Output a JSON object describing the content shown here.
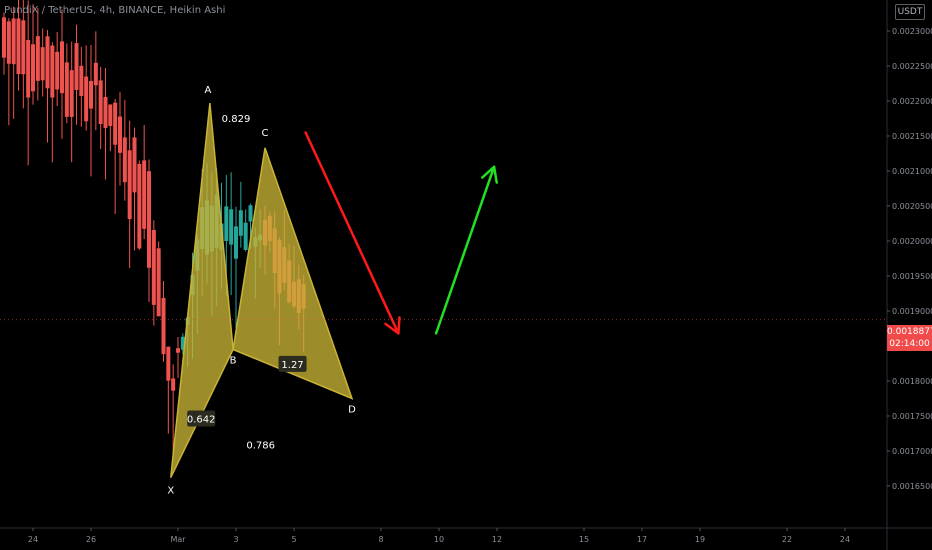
{
  "header": {
    "title": "PundiX / TetherUS, 4h, BINANCE, Heikin Ashi",
    "currency": "USDT"
  },
  "colors": {
    "background": "#000000",
    "up_candle": "#26a69a",
    "down_candle": "#ef5350",
    "pattern_fill": "#c9b336",
    "arrow_down": "#ff1a1a",
    "arrow_up": "#22e022",
    "price_tag": "#f04a4a"
  },
  "last_price": {
    "value": "0.0018877",
    "countdown": "02:14:00"
  },
  "chart_data": {
    "type": "candlestick",
    "title": "PundiX / TetherUS, 4h, BINANCE, Heikin Ashi",
    "y_axis": {
      "ticks": [
        "0.0023000",
        "0.0022500",
        "0.0022000",
        "0.0021500",
        "0.0021000",
        "0.0020500",
        "0.0020000",
        "0.0019500",
        "0.0019000",
        "0.0018500",
        "0.0018000",
        "0.0017500",
        "0.0017000",
        "0.0016500"
      ],
      "range": [
        0.00161,
        0.00234
      ]
    },
    "x_axis": {
      "ticks": [
        "24",
        "26",
        "Mar",
        "3",
        "5",
        "8",
        "10",
        "12",
        "15",
        "17",
        "19",
        "22",
        "24"
      ],
      "positions_days": [
        -5,
        -3,
        0,
        2,
        4,
        7,
        9,
        11,
        14,
        16,
        18,
        21,
        23
      ]
    },
    "pattern": {
      "name": "Harmonic (XABCD)",
      "points": [
        {
          "label": "X",
          "day": -0.25,
          "price": 0.001662
        },
        {
          "label": "A",
          "day": 1.1,
          "price": 0.002197
        },
        {
          "label": "B",
          "day": 1.9,
          "price": 0.001845
        },
        {
          "label": "C",
          "day": 3.0,
          "price": 0.002133
        },
        {
          "label": "D",
          "day": 6.0,
          "price": 0.001775
        }
      ],
      "ratios": [
        {
          "value": "0.829",
          "day": 2.0,
          "price": 0.002174
        },
        {
          "value": "0.642",
          "day": 0.8,
          "price": 0.001745,
          "boxed": true
        },
        {
          "value": "1.27",
          "day": 3.95,
          "price": 0.001823,
          "boxed": true
        },
        {
          "value": "0.786",
          "day": 2.85,
          "price": 0.001708
        }
      ]
    },
    "arrows": [
      {
        "direction": "down",
        "from": {
          "day": 4.4,
          "price": 0.002155
        },
        "to": {
          "day": 7.6,
          "price": 0.001868
        }
      },
      {
        "direction": "up",
        "from": {
          "day": 8.9,
          "price": 0.001868
        },
        "to": {
          "day": 10.9,
          "price": 0.002106
        }
      }
    ],
    "candles_sample": [
      {
        "day": -6.0,
        "open": 0.00232,
        "close": 0.00226,
        "high": 0.00234,
        "low": 0.00185
      },
      {
        "day": -4.0,
        "open": 0.00228,
        "close": 0.00221,
        "high": 0.00232,
        "low": 0.002
      },
      {
        "day": -2.5,
        "open": 0.00222,
        "close": 0.00218,
        "high": 0.00229,
        "low": 0.00208
      },
      {
        "day": -1.0,
        "open": 0.0021,
        "close": 0.00198,
        "high": 0.00215,
        "low": 0.00182
      },
      {
        "day": -0.2,
        "open": 0.0018,
        "close": 0.00177,
        "high": 0.00186,
        "low": 0.00166
      },
      {
        "day": 0.8,
        "open": 0.00198,
        "close": 0.00204,
        "high": 0.00212,
        "low": 0.0019
      },
      {
        "day": 2.2,
        "open": 0.002,
        "close": 0.00205,
        "high": 0.0021,
        "low": 0.00196
      },
      {
        "day": 3.4,
        "open": 0.00202,
        "close": 0.00196,
        "high": 0.00207,
        "low": 0.0019
      },
      {
        "day": 4.5,
        "open": 0.00191,
        "close": 0.00188,
        "high": 0.00194,
        "low": 0.00184
      }
    ]
  }
}
